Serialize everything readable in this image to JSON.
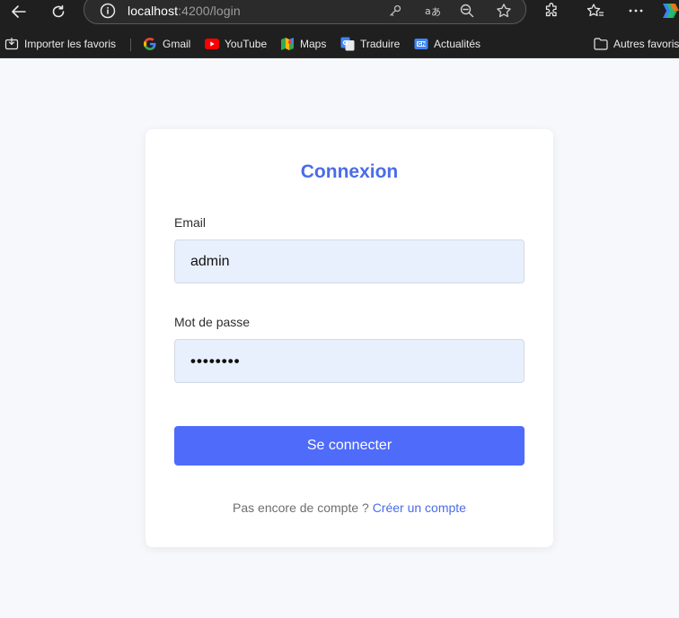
{
  "browser": {
    "url_host": "localhost",
    "url_path": ":4200/login",
    "bookmarks": [
      {
        "label": "Importer les favoris",
        "icon": "import-icon"
      },
      {
        "label": "Gmail",
        "icon": "google-icon"
      },
      {
        "label": "YouTube",
        "icon": "youtube-icon"
      },
      {
        "label": "Maps",
        "icon": "maps-icon"
      },
      {
        "label": "Traduire",
        "icon": "translate-icon"
      },
      {
        "label": "Actualités",
        "icon": "news-icon"
      }
    ],
    "other_bookmarks": "Autres favoris"
  },
  "login": {
    "title": "Connexion",
    "email_label": "Email",
    "email_value": "admin",
    "password_label": "Mot de passe",
    "password_value": "••••••••",
    "submit_label": "Se connecter",
    "footer_text": "Pas encore de compte ?",
    "footer_link": "Créer un compte"
  },
  "colors": {
    "accent": "#4a6ce8",
    "button": "#4f6bfa",
    "input_bg": "#e8f0fe",
    "page_bg": "#f7f8fb",
    "browser_bg": "#1f1f1f"
  }
}
